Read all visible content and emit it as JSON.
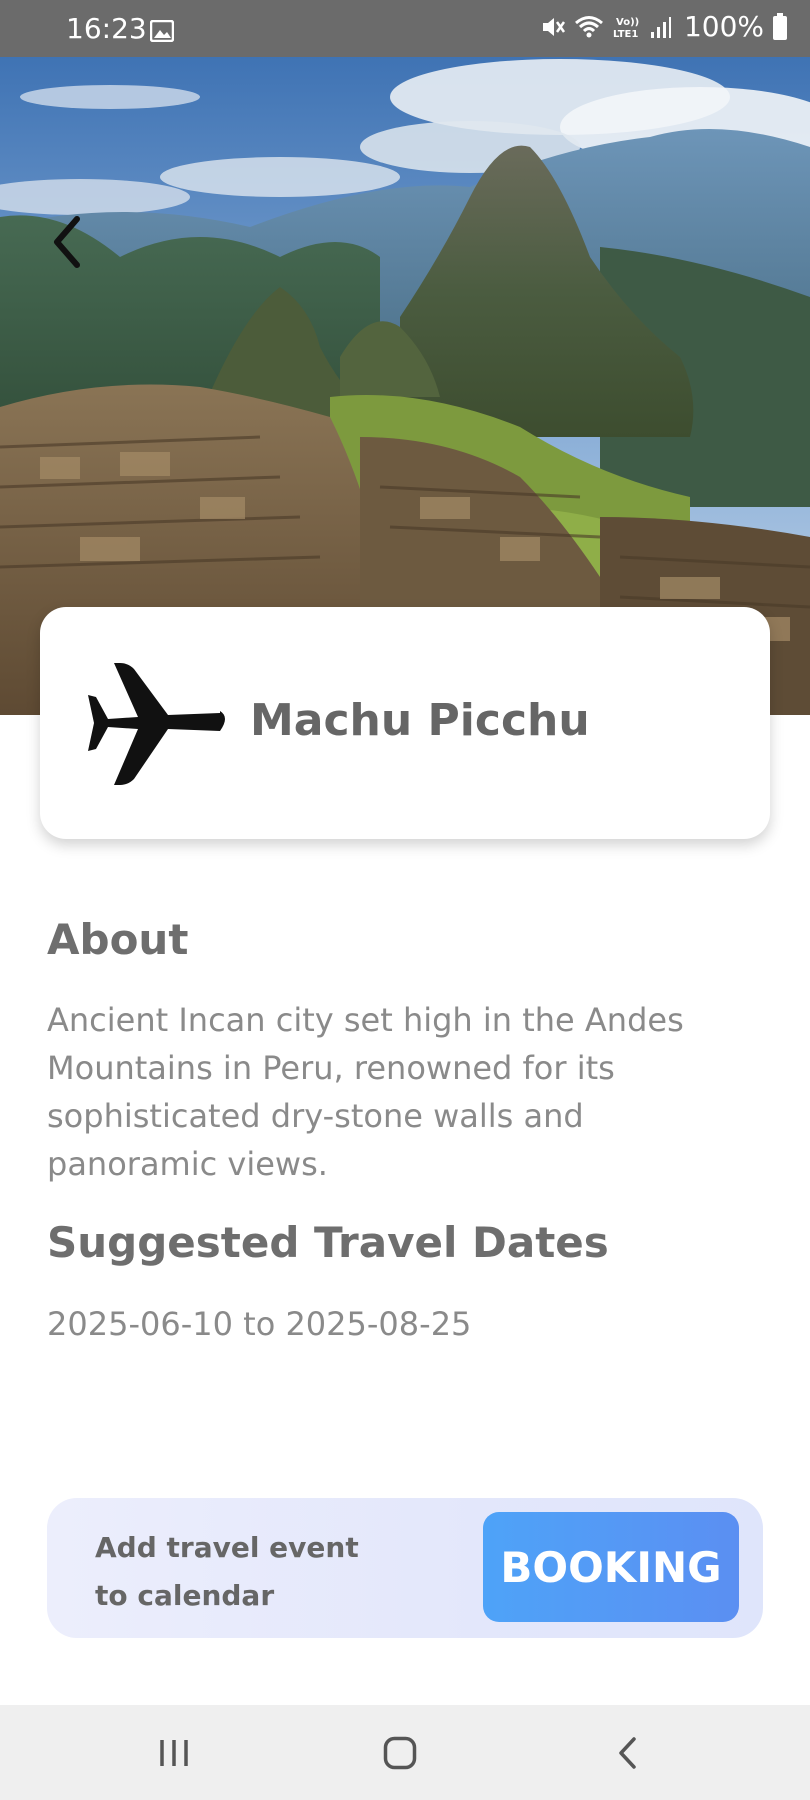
{
  "status_bar": {
    "time": "16:23",
    "battery": "100%",
    "icons": [
      "gallery-icon",
      "mute-icon",
      "wifi-icon",
      "volte-icon",
      "signal-icon",
      "battery-icon"
    ]
  },
  "hero": {
    "image": "machu-picchu-photo",
    "back_icon": "chevron-left-icon"
  },
  "place": {
    "icon": "airplane-icon",
    "name": "Machu Picchu"
  },
  "about": {
    "heading": "About",
    "text": "Ancient Incan city set high in the Andes Mountains in Peru, renowned for its sophisticated dry-stone walls and panoramic views."
  },
  "travel_dates": {
    "heading": "Suggested Travel Dates",
    "range": "2025-06-10 to 2025-08-25"
  },
  "booking": {
    "label": "Add travel event to calendar",
    "button_label": "BOOKING"
  },
  "nav_bar": {
    "icons": [
      "recents-icon",
      "home-icon",
      "back-icon"
    ]
  },
  "colors": {
    "status_bar": "#6b6b6b",
    "text_heading": "#6e6e6e",
    "text_body": "#8a8a8a",
    "booking_button": "#5b9af5",
    "booking_bar": "#e6e9fb"
  }
}
